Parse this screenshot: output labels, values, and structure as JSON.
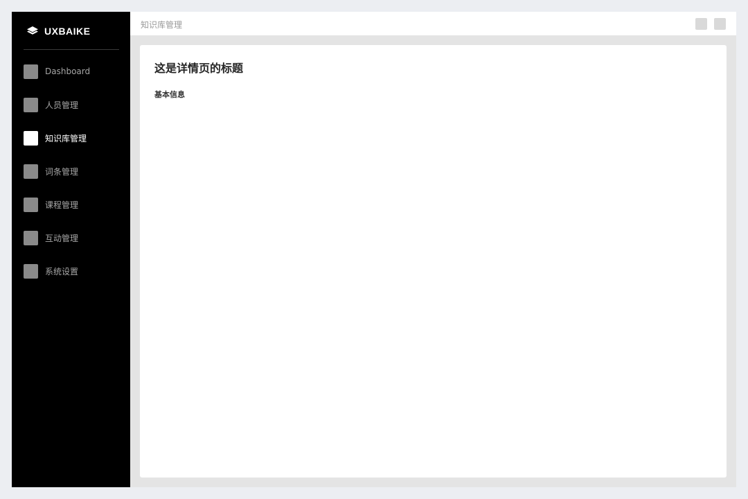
{
  "brand": {
    "name": "UXBAIKE",
    "logo_icon": "layers-icon"
  },
  "sidebar": {
    "items": [
      {
        "label": "Dashboard",
        "icon": "placeholder-icon",
        "active": false
      },
      {
        "label": "人员管理",
        "icon": "placeholder-icon",
        "active": false
      },
      {
        "label": "知识库管理",
        "icon": "placeholder-icon",
        "active": true
      },
      {
        "label": "词条管理",
        "icon": "placeholder-icon",
        "active": false
      },
      {
        "label": "课程管理",
        "icon": "placeholder-icon",
        "active": false
      },
      {
        "label": "互动管理",
        "icon": "placeholder-icon",
        "active": false
      },
      {
        "label": "系统设置",
        "icon": "placeholder-icon",
        "active": false
      }
    ]
  },
  "header": {
    "breadcrumb": "知识库管理",
    "actions": [
      {
        "icon": "placeholder-icon"
      },
      {
        "icon": "placeholder-icon"
      }
    ]
  },
  "main": {
    "title": "这是详情页的标题",
    "section_title": "基本信息"
  },
  "colors": {
    "page_background": "#eceef2",
    "sidebar_background": "#000000",
    "content_background": "#e4e4e4",
    "card_background": "#ffffff",
    "active_icon": "#ffffff",
    "inactive_icon": "#8a8a8a"
  }
}
